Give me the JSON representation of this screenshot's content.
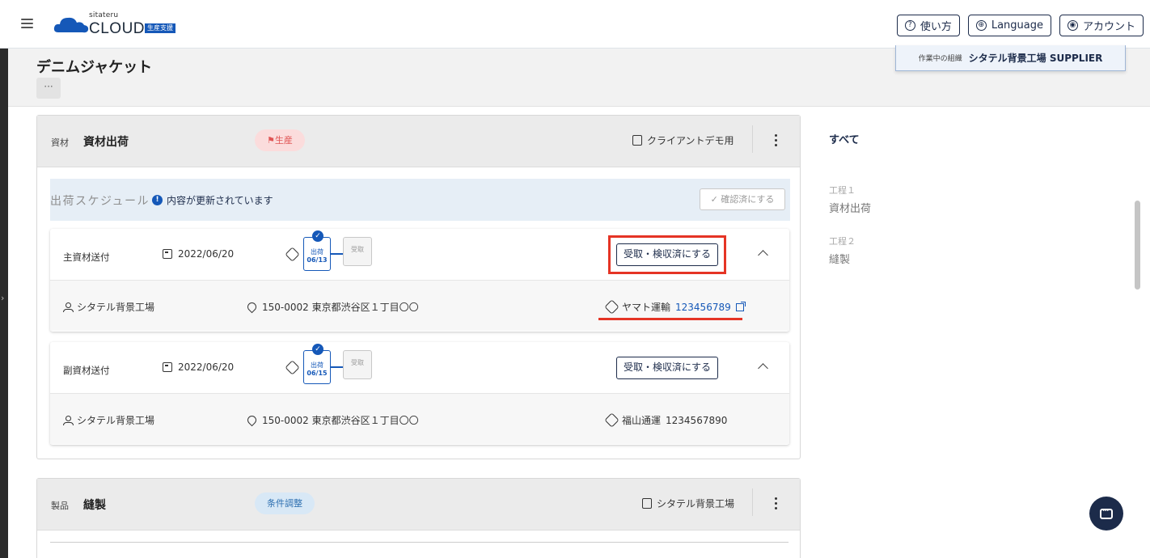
{
  "header": {
    "logo_small": "sitateru",
    "logo_main": "CLOUD",
    "logo_badge": "生産支援",
    "buttons": [
      {
        "label": "使い方",
        "icon": "help-circle-icon"
      },
      {
        "label": "Language",
        "icon": "globe-icon"
      },
      {
        "label": "アカウント",
        "icon": "account-icon"
      }
    ]
  },
  "page": {
    "title": "デニムジャケット",
    "more_label": "···",
    "org_label": "作業中の組織",
    "org_name": "シタテル背景工場 SUPPLIER"
  },
  "material_card": {
    "category": "資材",
    "title": "資材出荷",
    "status": "生産",
    "client": "クライアントデモ用",
    "schedule_title": "出荷スケジュール",
    "schedule_notice": "内容が更新されています",
    "confirm_button": "確認済にする",
    "shipments": [
      {
        "name": "主資材送付",
        "date": "2022/06/20",
        "step1_label": "出荷",
        "step1_date": "06/13",
        "step2_label": "受取",
        "action": "受取・検収済にする",
        "receiver": "シタテル背景工場",
        "address": "150-0002 東京都渋谷区１丁目〇〇",
        "carrier": "ヤマト運輸",
        "tracking": "123456789",
        "highlighted": true
      },
      {
        "name": "副資材送付",
        "date": "2022/06/20",
        "step1_label": "出荷",
        "step1_date": "06/15",
        "step2_label": "受取",
        "action": "受取・検収済にする",
        "receiver": "シタテル背景工場",
        "address": "150-0002 東京都渋谷区１丁目〇〇",
        "carrier": "福山通運",
        "tracking": "1234567890",
        "highlighted": false
      }
    ]
  },
  "product_card": {
    "category": "製品",
    "title": "縫製",
    "status": "条件調整",
    "factory": "シタテル背景工場"
  },
  "sidebar": {
    "all_label": "すべて",
    "steps": [
      {
        "label": "工程１",
        "value": "資材出荷"
      },
      {
        "label": "工程２",
        "value": "縫製"
      }
    ]
  },
  "colors": {
    "accent": "#1558b8",
    "navy": "#1c2b4a",
    "highlight": "#e53425",
    "status_red": "#e05555",
    "status_blue": "#2d6fb0"
  }
}
